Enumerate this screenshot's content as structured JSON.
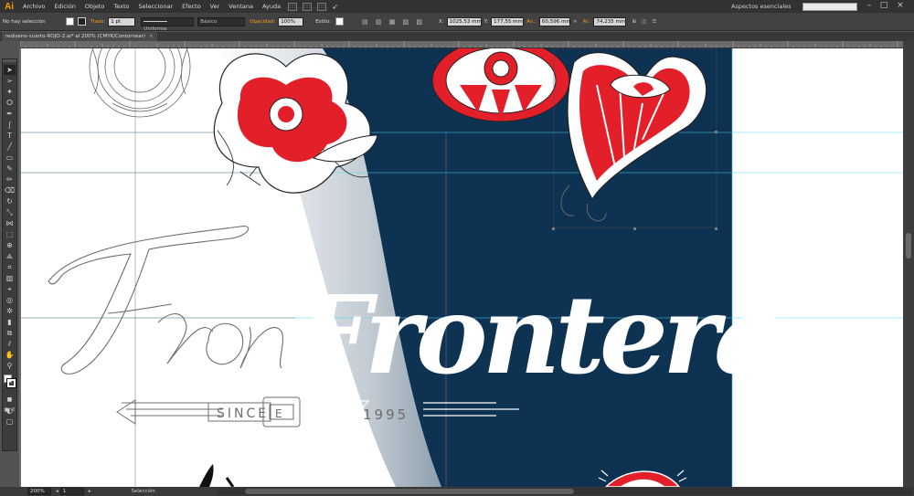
{
  "app": {
    "logo": "Ai"
  },
  "menu": {
    "items": [
      "Archivo",
      "Edición",
      "Objeto",
      "Texto",
      "Seleccionar",
      "Efecto",
      "Ver",
      "Ventana",
      "Ayuda"
    ],
    "workspace": "Aspectos esenciales"
  },
  "control_bar": {
    "selection_status": "No hay selección",
    "stroke_label": "Trazo:",
    "stroke_weight": "1 pt",
    "stroke_profile": "Uniforme",
    "brush": "Básico",
    "opacity_label": "Opacidad:",
    "opacity_value": "100%",
    "style_label": "Estilo:",
    "x_label": "X:",
    "x_value": "1025,53 mm",
    "y_label": "Y:",
    "y_value": "177,55 mm",
    "w_label": "An.:",
    "w_value": "60,596 mm",
    "h_label": "Al.:",
    "h_value": "74,235 mm"
  },
  "document_tab": {
    "title": "rediseno-cuarto-ROJO-2.ai* al 200% (CMYK/Contornear)",
    "close": "×"
  },
  "canvas": {
    "title_text": "Frontera",
    "badge_since": "SINCE",
    "badge_letter": "E",
    "badge_year": "1995"
  },
  "status_bar": {
    "zoom": "200%",
    "artboard": "1",
    "tool": "Selección"
  },
  "colors": {
    "navy": "#0e3352",
    "red": "#e3202a",
    "accent_orange": "#ff9a00"
  }
}
